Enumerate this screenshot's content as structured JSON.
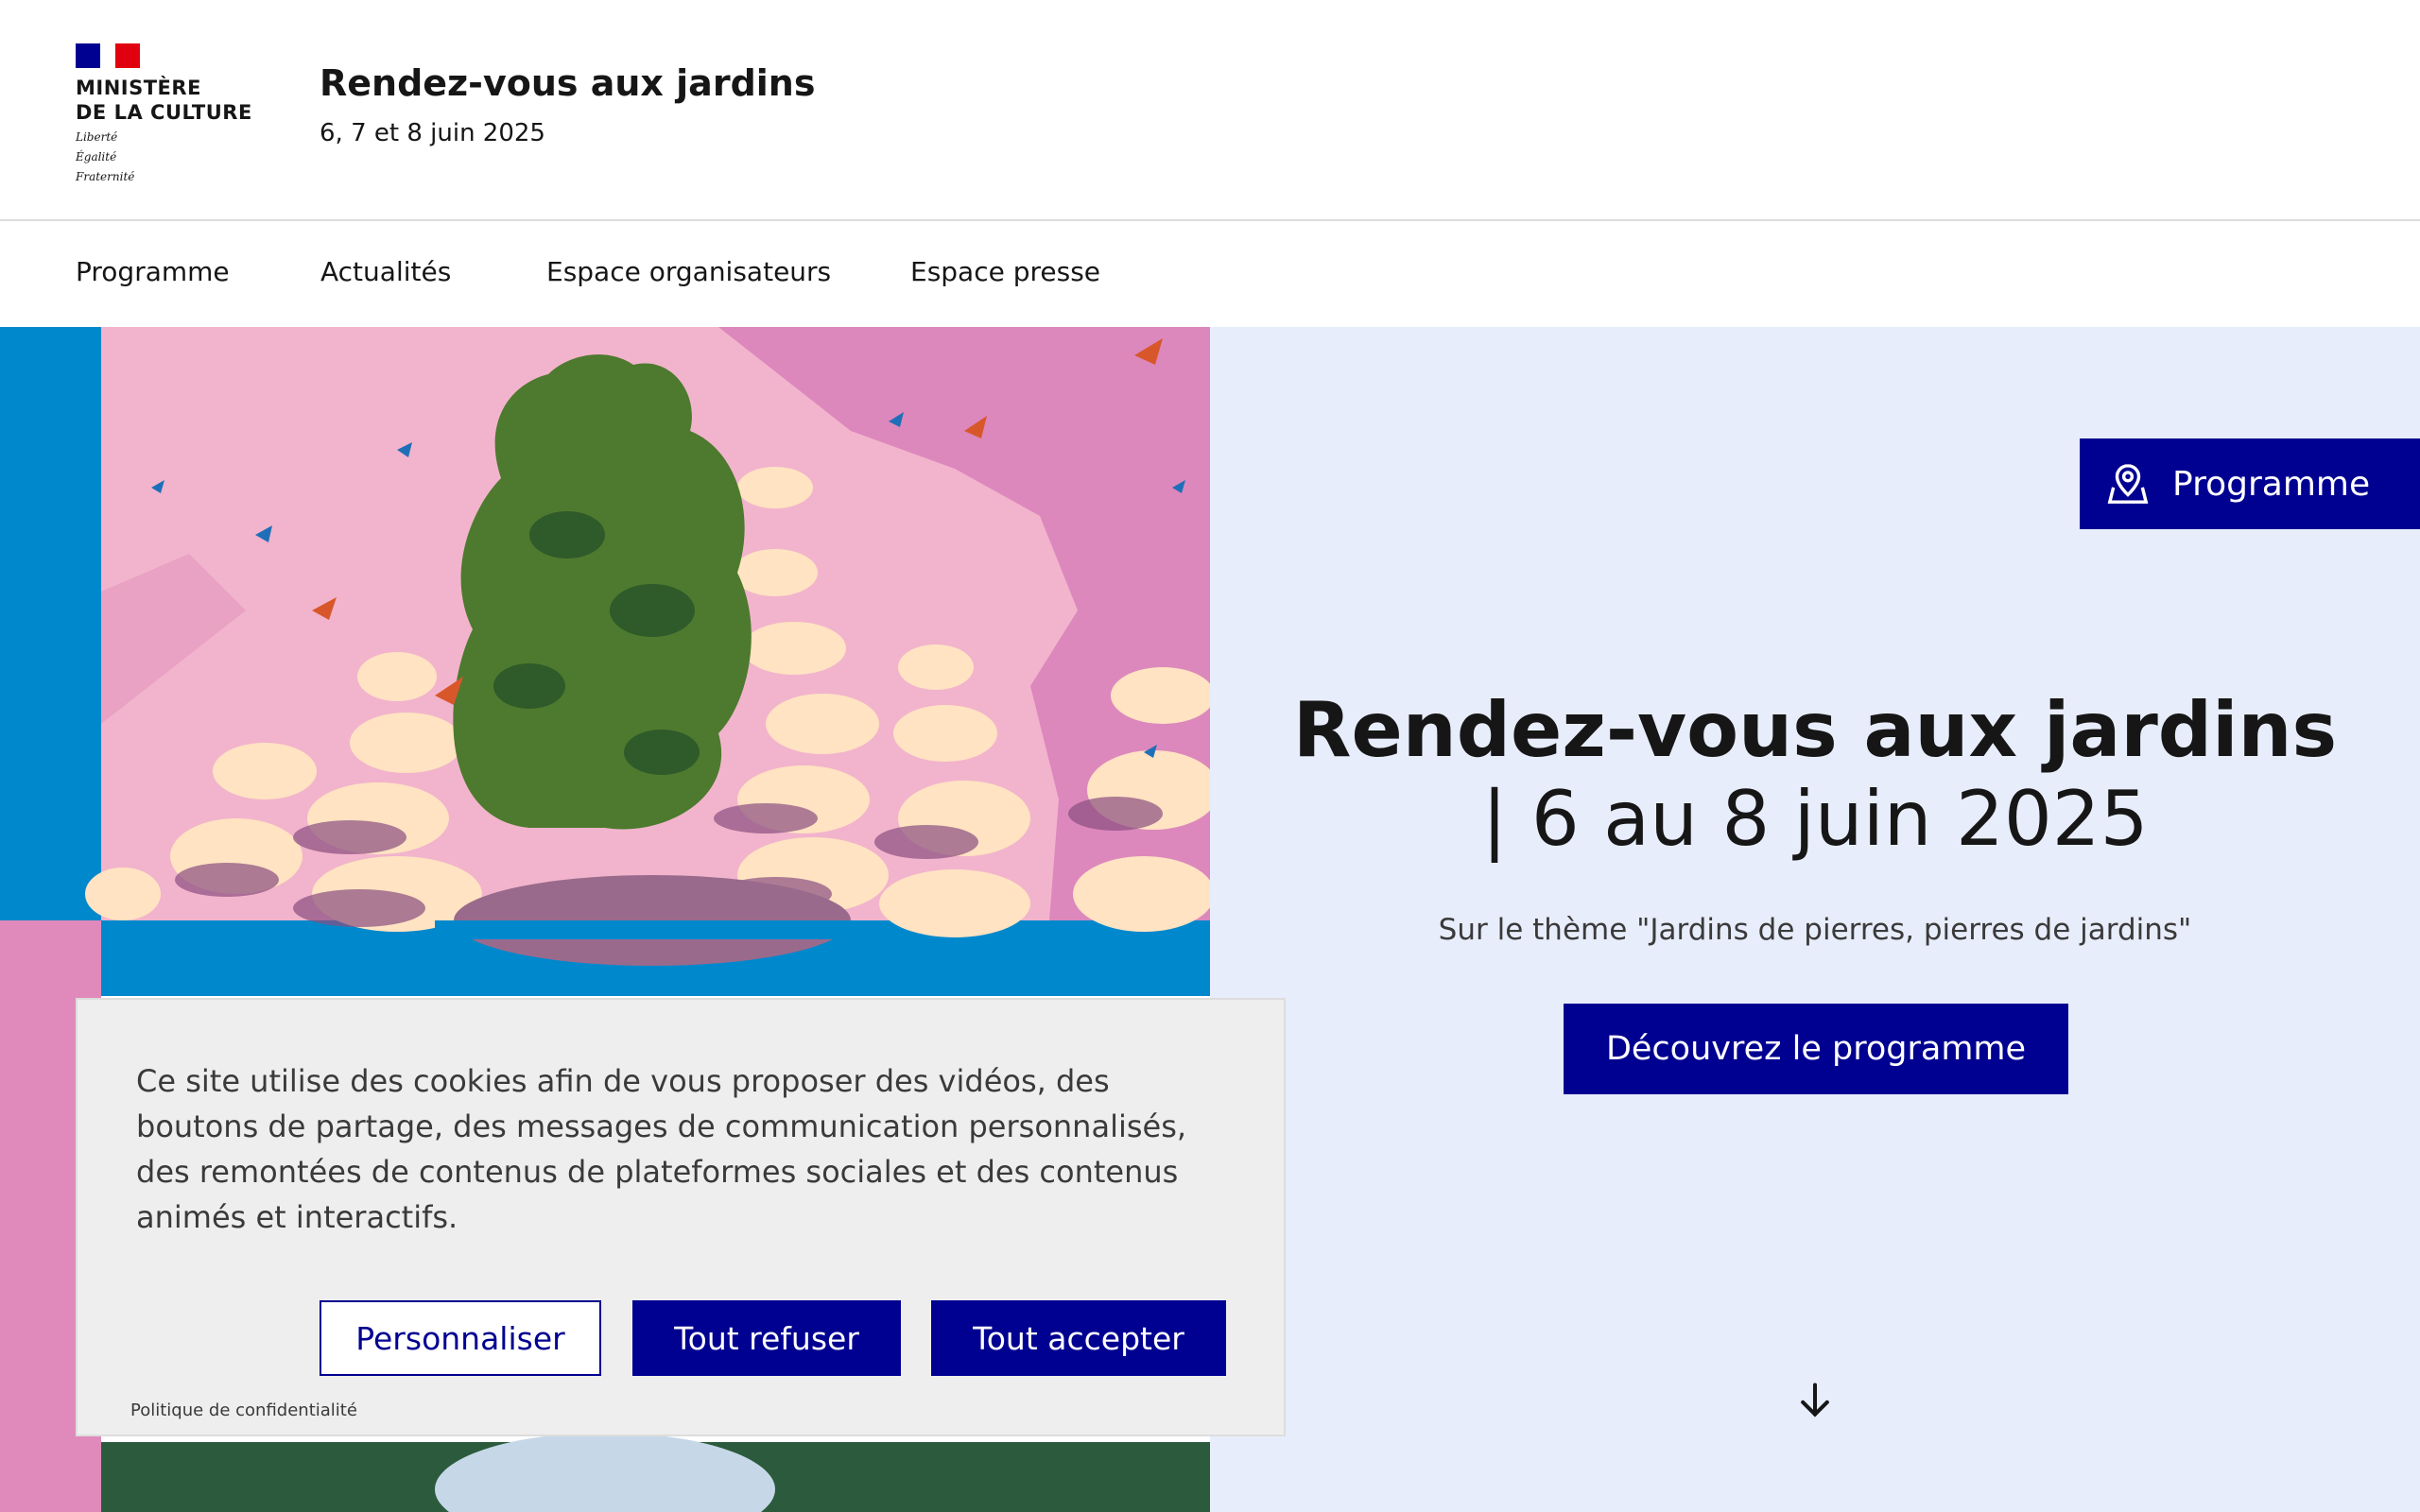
{
  "header": {
    "ministry_lines": [
      "MINISTÈRE",
      "DE LA CULTURE"
    ],
    "motto_lines": [
      "Liberté",
      "Égalité",
      "Fraternité"
    ],
    "site_title": "Rendez-vous aux jardins",
    "site_dates": "6, 7 et 8 juin 2025"
  },
  "nav": {
    "items": [
      "Programme",
      "Actualités",
      "Espace organisateurs",
      "Espace presse"
    ]
  },
  "hero": {
    "program_tab": "Programme",
    "title": "Rendez-vous aux jardins",
    "subtitle": "| 6 au 8 juin 2025",
    "theme": "Sur le thème \"Jardins de pierres, pierres de jardins\"",
    "cta": "Découvrez le programme"
  },
  "cookie": {
    "text": "Ce site utilise des cookies afin de vous proposer des vidéos, des boutons de partage, des messages de communication personnalisés, des remontées de contenus de plateformes sociales et des contenus animés et interactifs.",
    "customize": "Personnaliser",
    "refuse": "Tout refuser",
    "accept": "Tout accepter",
    "privacy": "Politique de confidentialité"
  },
  "colors": {
    "primary": "#000091",
    "hero_bg": "#e8edfb",
    "art_pink": "#f2b4cc",
    "art_blue": "#0088cc"
  },
  "icons": [
    "map-pin-icon",
    "arrow-down-icon"
  ]
}
